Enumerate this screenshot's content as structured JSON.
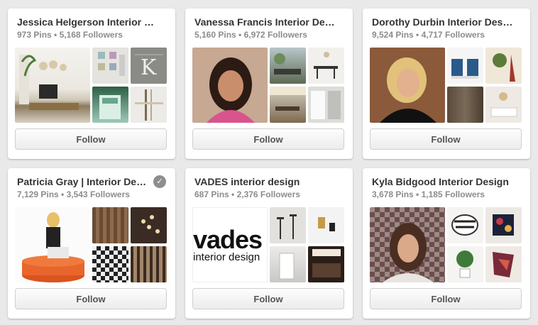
{
  "boards": [
    {
      "title": "Jessica Helgerson Interior …",
      "stats": "973 Pins • 5,168 Followers",
      "follow": "Follow",
      "verified": false
    },
    {
      "title": "Vanessa Francis Interior De…",
      "stats": "5,160 Pins • 6,972 Followers",
      "follow": "Follow",
      "verified": false
    },
    {
      "title": "Dorothy Durbin Interior Des…",
      "stats": "9,524 Pins • 4,717 Followers",
      "follow": "Follow",
      "verified": false
    },
    {
      "title": "Patricia Gray | Interior De…",
      "stats": "7,129 Pins • 3,543 Followers",
      "follow": "Follow",
      "verified": true
    },
    {
      "title": "VADES interior design",
      "stats": "687 Pins • 2,376 Followers",
      "follow": "Follow",
      "verified": false,
      "logo_word": "vades",
      "logo_sub": "interior design"
    },
    {
      "title": "Kyla Bidgood Interior Design",
      "stats": "3,678 Pins • 1,185 Followers",
      "follow": "Follow",
      "verified": false
    }
  ],
  "icons": {
    "verified": "check-circle-icon"
  }
}
